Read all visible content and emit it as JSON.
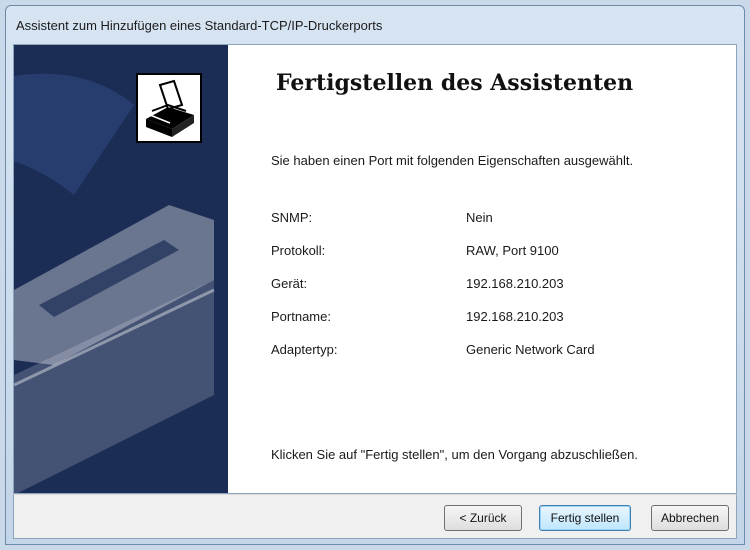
{
  "window": {
    "title": "Assistent zum Hinzufügen eines Standard-TCP/IP-Druckerports"
  },
  "sidebar": {
    "icon": "printer-icon",
    "background_color": "#1b2c55"
  },
  "main": {
    "heading": "Fertigstellen des Assistenten",
    "intro": "Sie haben einen Port mit folgenden Eigenschaften ausgewählt.",
    "properties": [
      {
        "label": "SNMP:",
        "value": "Nein"
      },
      {
        "label": "Protokoll:",
        "value": "RAW, Port 9100"
      },
      {
        "label": "Gerät:",
        "value": "192.168.210.203"
      },
      {
        "label": "Portname:",
        "value": "192.168.210.203"
      },
      {
        "label": "Adaptertyp:",
        "value": "Generic Network Card"
      }
    ],
    "outro": "Klicken Sie auf \"Fertig stellen\", um den Vorgang abzuschließen."
  },
  "buttons": {
    "back": "< Zurück",
    "finish": "Fertig stellen",
    "cancel": "Abbrechen"
  }
}
